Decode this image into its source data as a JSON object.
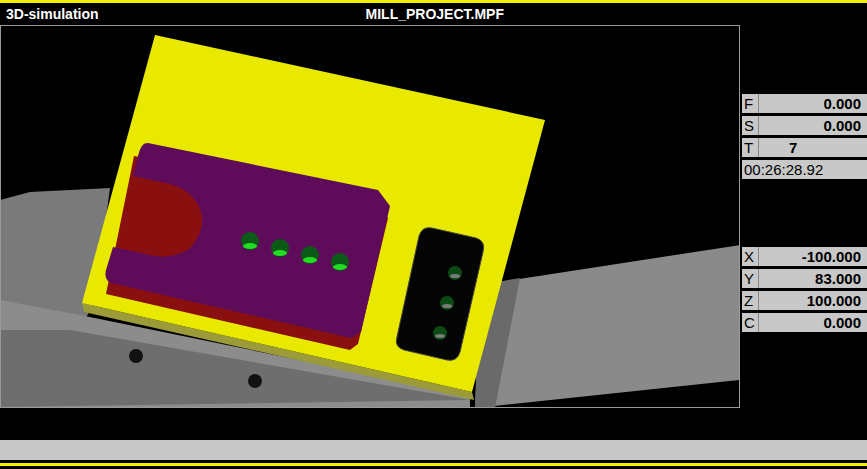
{
  "window": {
    "title": "3D-simulation",
    "program": "MILL_PROJECT.MPF"
  },
  "feed_spindle": [
    {
      "label": "F",
      "value": "0.000"
    },
    {
      "label": "S",
      "value": "0.000"
    }
  ],
  "tool": {
    "label": "T",
    "value": "7"
  },
  "time": "00:26:28.92",
  "axes": [
    {
      "label": "X",
      "value": "-100.000"
    },
    {
      "label": "Y",
      "value": "83.000"
    },
    {
      "label": "Z",
      "value": "100.000"
    },
    {
      "label": "C",
      "value": "0.000"
    }
  ],
  "message": ""
}
